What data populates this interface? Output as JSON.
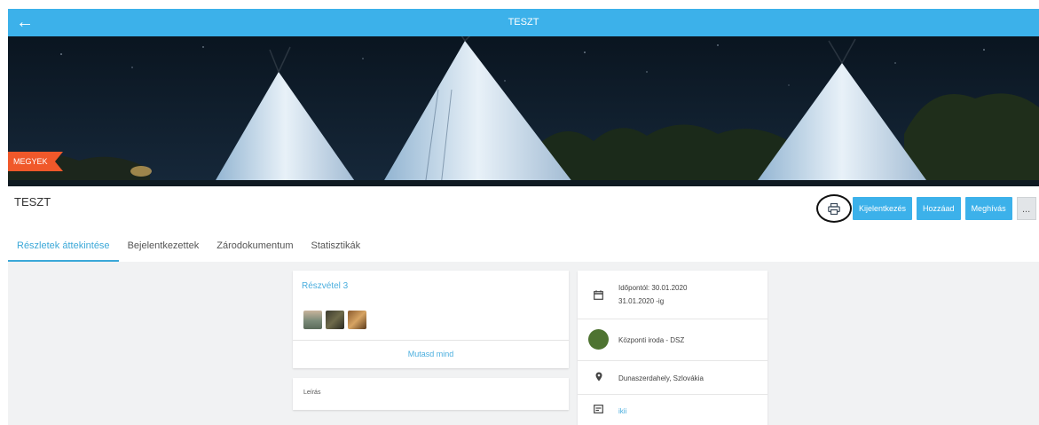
{
  "topbar": {
    "back_icon": "arrow-left-icon",
    "title": "TESZT"
  },
  "hero": {
    "badge": "MEGYEK"
  },
  "event": {
    "title": "TESZT"
  },
  "actions": {
    "print_icon": "printer-icon",
    "checkout": "Kijelentkezés",
    "add": "Hozzáad",
    "invite": "Meghívás",
    "more": "..."
  },
  "tabs": [
    {
      "label": "Részletek áttekintése",
      "active": true
    },
    {
      "label": "Bejelentkezettek",
      "active": false
    },
    {
      "label": "Zárodokumentum",
      "active": false
    },
    {
      "label": "Statisztikák",
      "active": false
    }
  ],
  "participation": {
    "label": "Részvétel 3",
    "show_all": "Mutasd mind"
  },
  "description": {
    "label": "Leírás"
  },
  "info": {
    "date_line1": "Időpontól: 30.01.2020",
    "date_line2": "31.01.2020 -ig",
    "organizer": "Központi iroda - DSZ",
    "location": "Dunaszerdahely, Szlovákia",
    "extra": "ikii"
  },
  "colors": {
    "accent": "#3cb1ea",
    "badge": "#f0582a",
    "organizer_dot": "#4e7331"
  }
}
